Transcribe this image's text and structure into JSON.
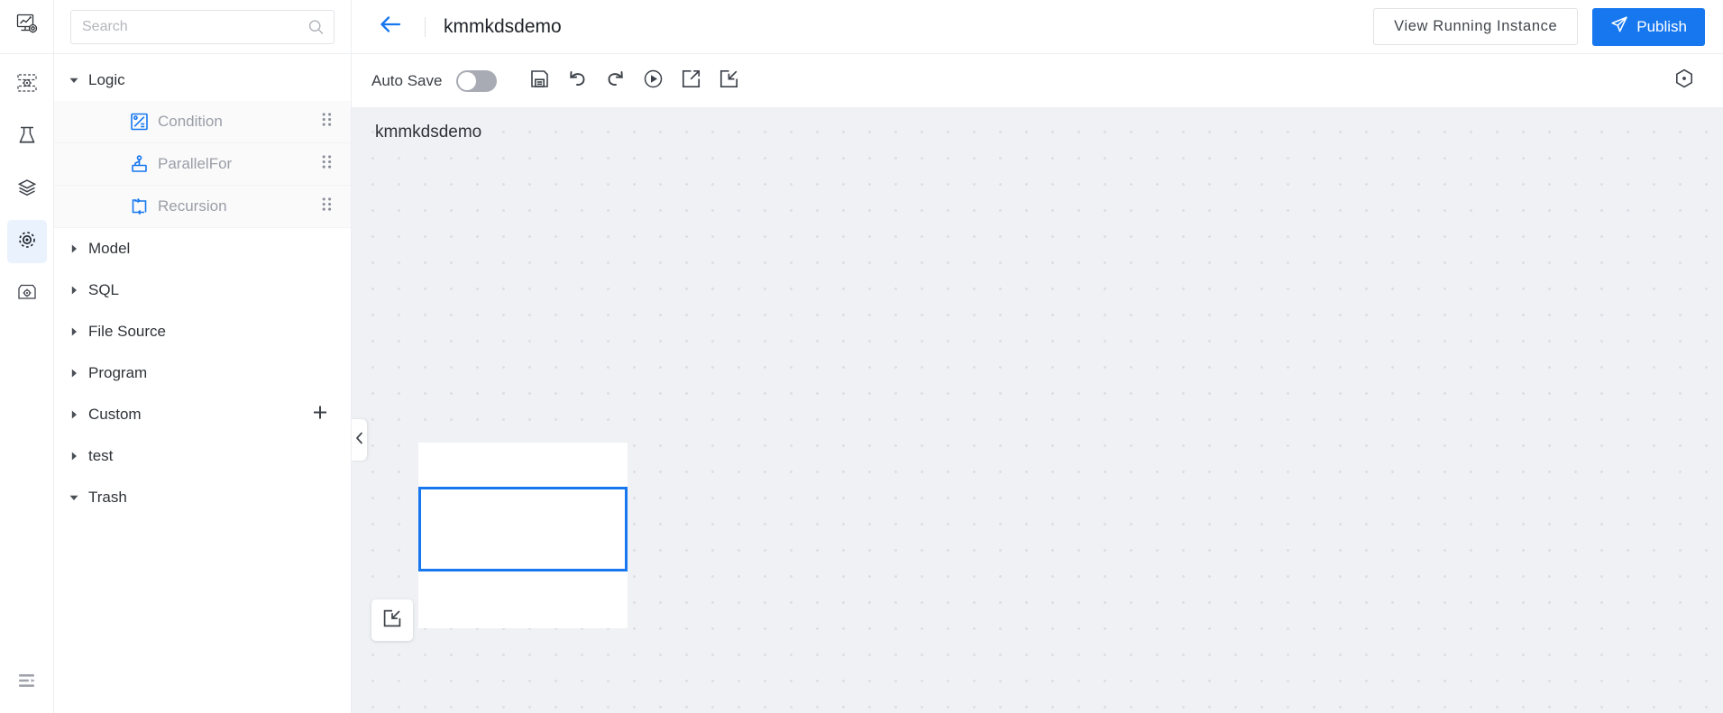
{
  "rail": {
    "logo": {
      "icon": "analytics-settings-logo-icon"
    },
    "items": [
      {
        "icon": "data-server-icon",
        "name": "data-server",
        "active": false
      },
      {
        "icon": "flask-experiment-icon",
        "name": "flask-experiment",
        "active": false
      },
      {
        "icon": "layers-stack-icon",
        "name": "layers-stack",
        "active": false
      },
      {
        "icon": "pipeline-target-icon",
        "name": "pipeline-target",
        "active": true
      },
      {
        "icon": "box-gear-icon",
        "name": "box-settings",
        "active": false
      }
    ],
    "bottom": {
      "icon": "expand-panel-icon",
      "name": "expand-panel"
    }
  },
  "search": {
    "placeholder": "Search",
    "value": "",
    "icon": "search-icon"
  },
  "sidebar": {
    "groups": [
      {
        "label": "Logic",
        "expanded": true,
        "has_add": false,
        "items": [
          {
            "label": "Condition",
            "icon": "condition-icon"
          },
          {
            "label": "ParallelFor",
            "icon": "parallel-for-icon"
          },
          {
            "label": "Recursion",
            "icon": "recursion-icon"
          }
        ]
      },
      {
        "label": "Model",
        "expanded": false,
        "has_add": false,
        "items": []
      },
      {
        "label": "SQL",
        "expanded": false,
        "has_add": false,
        "items": []
      },
      {
        "label": "File Source",
        "expanded": false,
        "has_add": false,
        "items": []
      },
      {
        "label": "Program",
        "expanded": false,
        "has_add": false,
        "items": []
      },
      {
        "label": "Custom",
        "expanded": false,
        "has_add": true,
        "items": []
      },
      {
        "label": "test",
        "expanded": false,
        "has_add": false,
        "items": []
      },
      {
        "label": "Trash",
        "expanded": true,
        "has_add": false,
        "items": []
      }
    ]
  },
  "topbar": {
    "back_icon": "arrow-left-icon",
    "title": "kmmkdsdemo",
    "view_instance_label": "View  Running  Instance",
    "publish_label": "Publish",
    "publish_icon": "send-icon"
  },
  "toolbar": {
    "auto_save_label": "Auto Save",
    "auto_save_on": false,
    "icons": [
      {
        "name": "save-icon",
        "label": "Save"
      },
      {
        "name": "undo-icon",
        "label": "Undo"
      },
      {
        "name": "redo-icon",
        "label": "Redo"
      },
      {
        "name": "run-icon",
        "label": "Run"
      },
      {
        "name": "export-icon",
        "label": "Export"
      },
      {
        "name": "import-icon",
        "label": "Import"
      }
    ],
    "settings_icon": "hexagon-settings-icon"
  },
  "canvas": {
    "title": "kmmkdsdemo",
    "collapse_icon": "chevron-left-icon",
    "node_tool_icon": "import-node-icon",
    "grid": true
  },
  "colors": {
    "accent": "#1677ef",
    "rail_active_bg": "#eaf2fd",
    "canvas_bg": "#f0f1f5",
    "grid_dot": "#dcdee4",
    "muted_text": "#9a9ea6"
  }
}
